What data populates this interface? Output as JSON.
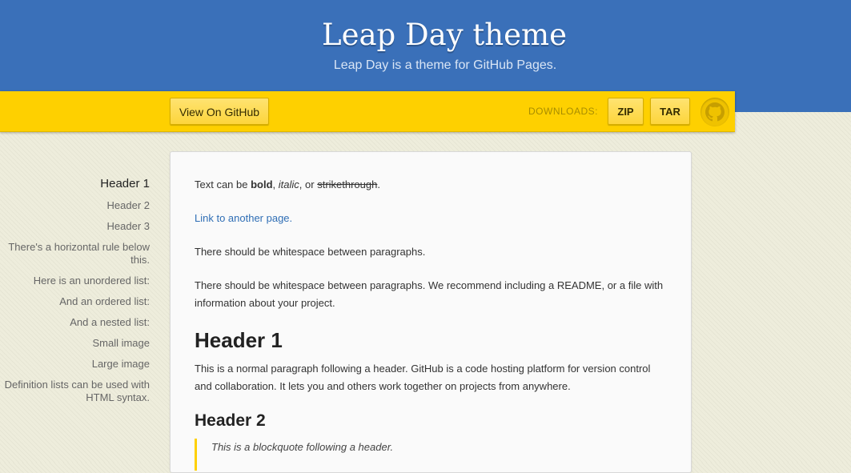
{
  "header": {
    "title": "Leap Day theme",
    "tagline": "Leap Day is a theme for GitHub Pages."
  },
  "banner": {
    "view_github_label": "View On GitHub",
    "downloads_label": "DOWNLOADS:",
    "zip_label": "ZIP",
    "tar_label": "TAR",
    "github_icon": "octocat-icon"
  },
  "sidebar": {
    "items": [
      {
        "label": "Header 1",
        "active": true
      },
      {
        "label": "Header 2"
      },
      {
        "label": "Header 3"
      },
      {
        "label": "There's a horizontal rule below this."
      },
      {
        "label": "Here is an unordered list:"
      },
      {
        "label": "And an ordered list:"
      },
      {
        "label": "And a nested list:"
      },
      {
        "label": "Small image"
      },
      {
        "label": "Large image"
      },
      {
        "label": "Definition lists can be used with HTML syntax."
      }
    ]
  },
  "content": {
    "p1": {
      "prefix": "Text can be ",
      "bold": "bold",
      "sep1": ", ",
      "italic": "italic",
      "sep2": ", or ",
      "strike": "strikethrough",
      "suffix": "."
    },
    "link_text": "Link to another page.",
    "p2": "There should be whitespace between paragraphs.",
    "p3": "There should be whitespace between paragraphs. We recommend including a README, or a file with information about your project.",
    "h1": "Header 1",
    "p4": "This is a normal paragraph following a header. GitHub is a code hosting platform for version control and collaboration. It lets you and others work together on projects from anywhere.",
    "h2": "Header 2",
    "blockquote": "This is a blockquote following a header."
  },
  "colors": {
    "header_blue": "#3a70b9",
    "banner_yellow": "#fed000",
    "link_blue": "#2f6eb5"
  }
}
